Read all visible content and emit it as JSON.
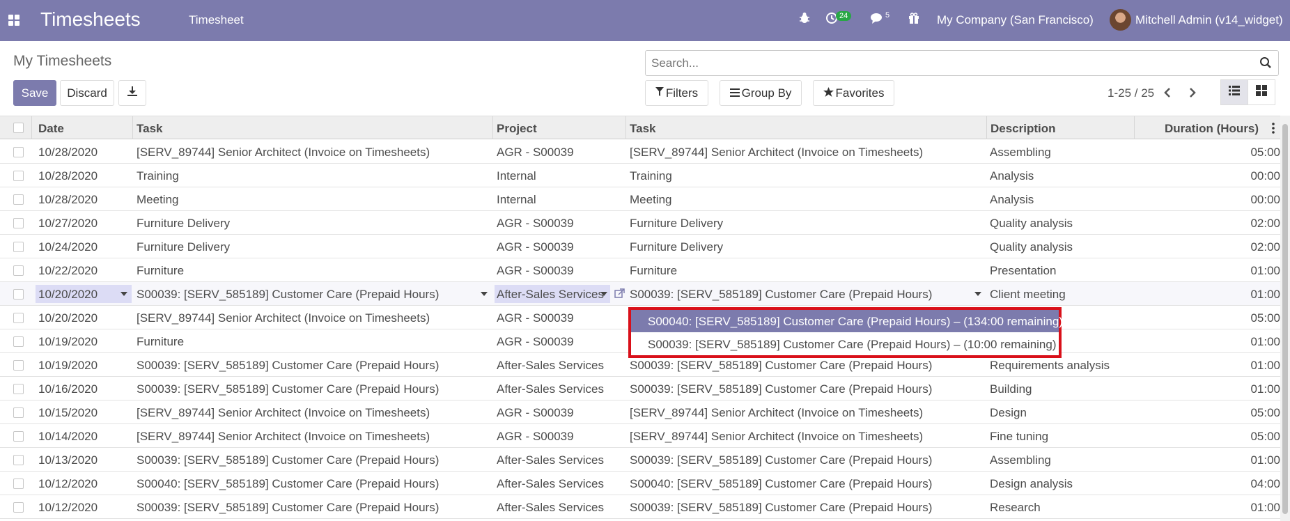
{
  "navbar": {
    "app_title": "Timesheets",
    "menu_item": "Timesheet",
    "activity_count": "24",
    "message_count": "5",
    "company": "My Company (San Francisco)",
    "user": "Mitchell Admin (v14_widget)"
  },
  "control_panel": {
    "title": "My Timesheets",
    "save_label": "Save",
    "discard_label": "Discard",
    "search_placeholder": "Search...",
    "filters_label": "Filters",
    "groupby_label": "Group By",
    "favorites_label": "Favorites",
    "pager": "1-25 / 25"
  },
  "table": {
    "headers": [
      "Date",
      "Task",
      "Project",
      "Task",
      "Description",
      "Duration (Hours)"
    ],
    "rows": [
      [
        "10/28/2020",
        "[SERV_89744] Senior Architect (Invoice on Timesheets)",
        "AGR - S00039",
        "[SERV_89744] Senior Architect (Invoice on Timesheets)",
        "Assembling",
        "05:00"
      ],
      [
        "10/28/2020",
        "Training",
        "Internal",
        "Training",
        "Analysis",
        "00:00"
      ],
      [
        "10/28/2020",
        "Meeting",
        "Internal",
        "Meeting",
        "Analysis",
        "00:00"
      ],
      [
        "10/27/2020",
        "Furniture Delivery",
        "AGR - S00039",
        "Furniture Delivery",
        "Quality analysis",
        "02:00"
      ],
      [
        "10/24/2020",
        "Furniture Delivery",
        "AGR - S00039",
        "Furniture Delivery",
        "Quality analysis",
        "02:00"
      ],
      [
        "10/22/2020",
        "Furniture",
        "AGR - S00039",
        "Furniture",
        "Presentation",
        "01:00"
      ],
      [
        "10/20/2020",
        "S00039: [SERV_585189] Customer Care (Prepaid Hours)",
        "After-Sales Services",
        "S00039: [SERV_585189] Customer Care (Prepaid Hours)",
        "Client meeting",
        "01:00"
      ],
      [
        "10/20/2020",
        "[SERV_89744] Senior Architect (Invoice on Timesheets)",
        "AGR - S00039",
        "",
        "",
        "05:00"
      ],
      [
        "10/19/2020",
        "Furniture",
        "AGR - S00039",
        "",
        "",
        "01:00"
      ],
      [
        "10/19/2020",
        "S00039: [SERV_585189] Customer Care (Prepaid Hours)",
        "After-Sales Services",
        "S00039: [SERV_585189] Customer Care (Prepaid Hours)",
        "Requirements analysis",
        "01:00"
      ],
      [
        "10/16/2020",
        "S00039: [SERV_585189] Customer Care (Prepaid Hours)",
        "After-Sales Services",
        "S00039: [SERV_585189] Customer Care (Prepaid Hours)",
        "Building",
        "01:00"
      ],
      [
        "10/15/2020",
        "[SERV_89744] Senior Architect (Invoice on Timesheets)",
        "AGR - S00039",
        "[SERV_89744] Senior Architect (Invoice on Timesheets)",
        "Design",
        "05:00"
      ],
      [
        "10/14/2020",
        "[SERV_89744] Senior Architect (Invoice on Timesheets)",
        "AGR - S00039",
        "[SERV_89744] Senior Architect (Invoice on Timesheets)",
        "Fine tuning",
        "05:00"
      ],
      [
        "10/13/2020",
        "S00039: [SERV_585189] Customer Care (Prepaid Hours)",
        "After-Sales Services",
        "S00039: [SERV_585189] Customer Care (Prepaid Hours)",
        "Assembling",
        "01:00"
      ],
      [
        "10/12/2020",
        "S00040: [SERV_585189] Customer Care (Prepaid Hours)",
        "After-Sales Services",
        "S00040: [SERV_585189] Customer Care (Prepaid Hours)",
        "Design analysis",
        "04:00"
      ],
      [
        "10/12/2020",
        "S00039: [SERV_585189] Customer Care (Prepaid Hours)",
        "After-Sales Services",
        "S00039: [SERV_585189] Customer Care (Prepaid Hours)",
        "Research",
        "01:00"
      ]
    ]
  },
  "autocomplete": {
    "items": [
      "S00040: [SERV_585189] Customer Care (Prepaid Hours) – (134:00 remaining)",
      "S00039: [SERV_585189] Customer Care (Prepaid Hours) – (10:00 remaining)"
    ]
  },
  "colors": {
    "brand": "#7c7bad",
    "highlight_border": "#d9101a",
    "edit_bg": "#dcdcf5"
  }
}
